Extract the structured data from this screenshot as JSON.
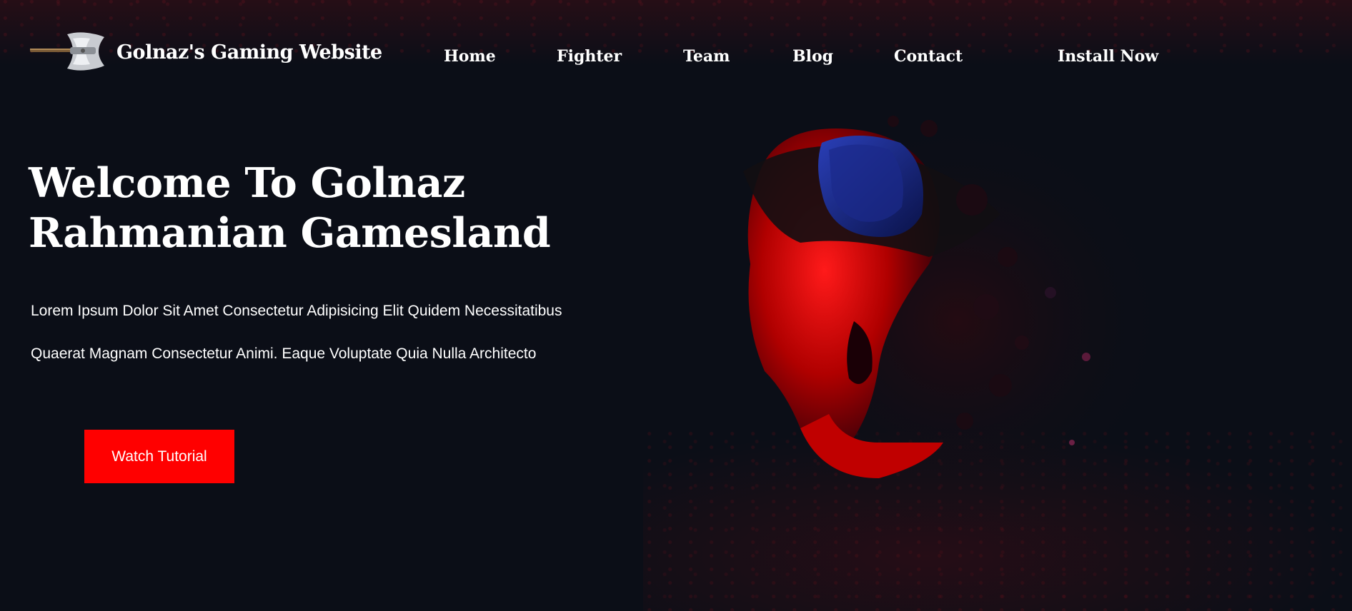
{
  "header": {
    "site_title": "Golnaz's Gaming Website",
    "logo_icon": "battle-axe-icon",
    "nav": [
      {
        "label": "Home"
      },
      {
        "label": "Fighter"
      },
      {
        "label": "Team"
      },
      {
        "label": "Blog"
      },
      {
        "label": "Contact"
      },
      {
        "label": "Install Now"
      }
    ]
  },
  "hero": {
    "title_line1": "Welcome To Golnaz",
    "title_line2": "Rahmanian Gamesland",
    "paragraph_line1": "Lorem Ipsum Dolor Sit Amet Consectetur Adipisicing Elit Quidem Necessitatibus",
    "paragraph_line2": "Quaerat Magnam Consectetur Animi. Eaque Voluptate Quia Nulla Architecto",
    "button_label": "Watch Tutorial",
    "image": "vr-gamer-screaming-illustration"
  },
  "colors": {
    "background": "#0b0e17",
    "accent": "#ff0000",
    "text": "#ffffff"
  }
}
